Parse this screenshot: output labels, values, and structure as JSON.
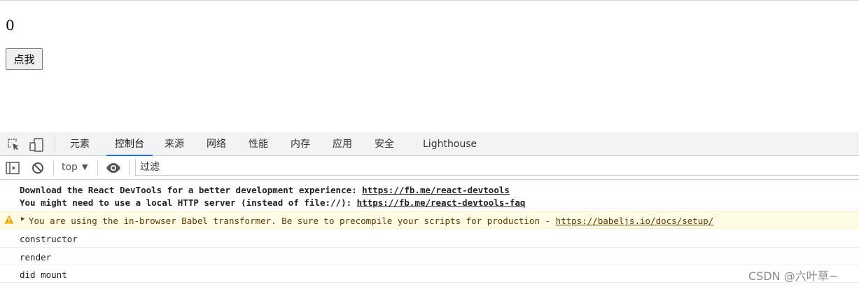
{
  "page": {
    "count": "0",
    "button_label": "点我"
  },
  "devtools": {
    "tabs": [
      {
        "label": "元素"
      },
      {
        "label": "控制台"
      },
      {
        "label": "来源"
      },
      {
        "label": "网络"
      },
      {
        "label": "性能"
      },
      {
        "label": "内存"
      },
      {
        "label": "应用"
      },
      {
        "label": "安全"
      },
      {
        "label": "Lighthouse"
      }
    ],
    "active_tab": "控制台",
    "accent": "#1a73e8",
    "context_label": "top",
    "filter_placeholder": "过滤"
  },
  "console": {
    "devtools_line1_text": "Download the React DevTools for a better development experience: ",
    "devtools_line1_link": "https://fb.me/react-devtools",
    "devtools_line2_text": "You might need to use a local HTTP server (instead of file://): ",
    "devtools_line2_link": "https://fb.me/react-devtools-faq",
    "warning_text": "You are using the in-browser Babel transformer. Be sure to precompile your scripts for production - ",
    "warning_link": "https://babeljs.io/docs/setup/",
    "logs": [
      "constructor",
      "render",
      "did mount"
    ]
  },
  "watermark": "CSDN @六叶草~"
}
